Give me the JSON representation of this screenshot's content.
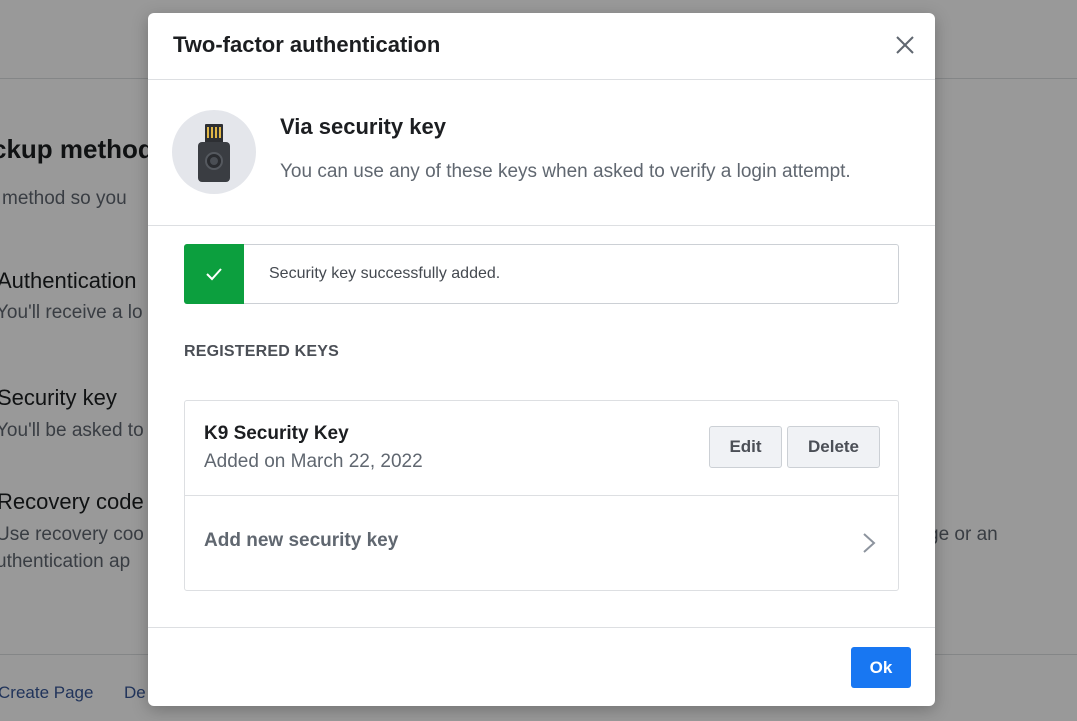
{
  "background": {
    "heading": "ckup method",
    "subtitle": "method so you",
    "options": [
      {
        "title": "Authentication",
        "desc": "You'll receive a lo"
      },
      {
        "title": "Security key",
        "desc": "You'll be asked to"
      },
      {
        "title": "Recovery code",
        "desc": "Use recovery coo",
        "desc2": "uthentication ap"
      }
    ],
    "right_text": "ge or an",
    "footer_links": [
      "Create Page",
      "De"
    ]
  },
  "dialog": {
    "title": "Two-factor authentication",
    "close_icon": "close-icon",
    "intro": {
      "title": "Via security key",
      "description": "You can use any of these keys when asked to verify a login attempt."
    },
    "success_message": "Security key successfully added.",
    "registered_label": "REGISTERED KEYS",
    "keys": [
      {
        "name": "K9 Security Key",
        "added": "Added on March 22, 2022",
        "edit_label": "Edit",
        "delete_label": "Delete"
      }
    ],
    "add_key_label": "Add new security key",
    "ok_label": "Ok"
  },
  "colors": {
    "primary": "#1877f2",
    "success": "#0c9f3e",
    "overlay": "rgba(0,0,0,0.4)"
  }
}
